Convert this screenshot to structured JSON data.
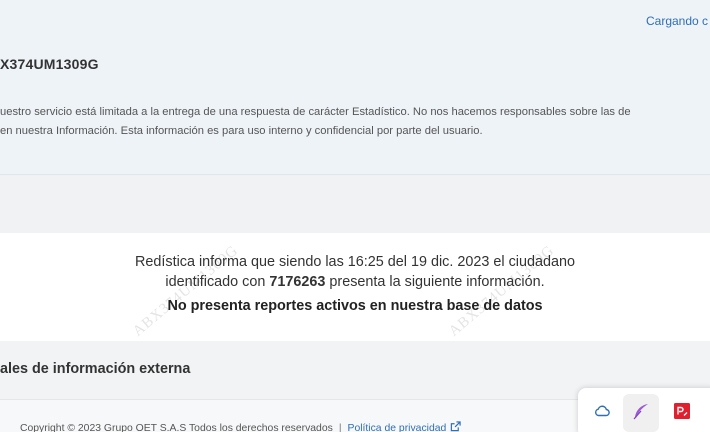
{
  "header": {
    "loading_text": "Cargando c",
    "code": "X374UM1309G",
    "disclaimer_line1": "uestro servicio está limitada a la entrega de una respuesta de carácter Estadístico. No nos hacemos responsables sobre las de",
    "disclaimer_line2": "en nuestra Información. Esta información es para uso interno y confidencial por parte del usuario."
  },
  "report": {
    "line1": "Redística informa que siendo las 16:25 del 19 dic. 2023 el ciudadano",
    "line2_prefix": "identificado con ",
    "id_number": "7176263",
    "line2_suffix": " presenta la siguiente información.",
    "result": "No presenta reportes activos en nuestra base de datos",
    "watermark": "ABX374UM1309G"
  },
  "section": {
    "title": "ales de información externa"
  },
  "footer": {
    "copyright": "Copyright © 2023 Grupo OET S.A.S Todos los derechos reservados",
    "separator": "|",
    "privacy_label": "Política de privacidad"
  },
  "dock": {
    "items": [
      "cloud-icon",
      "feather-icon",
      "pdf-icon"
    ],
    "accent": "#2f6fb5"
  }
}
